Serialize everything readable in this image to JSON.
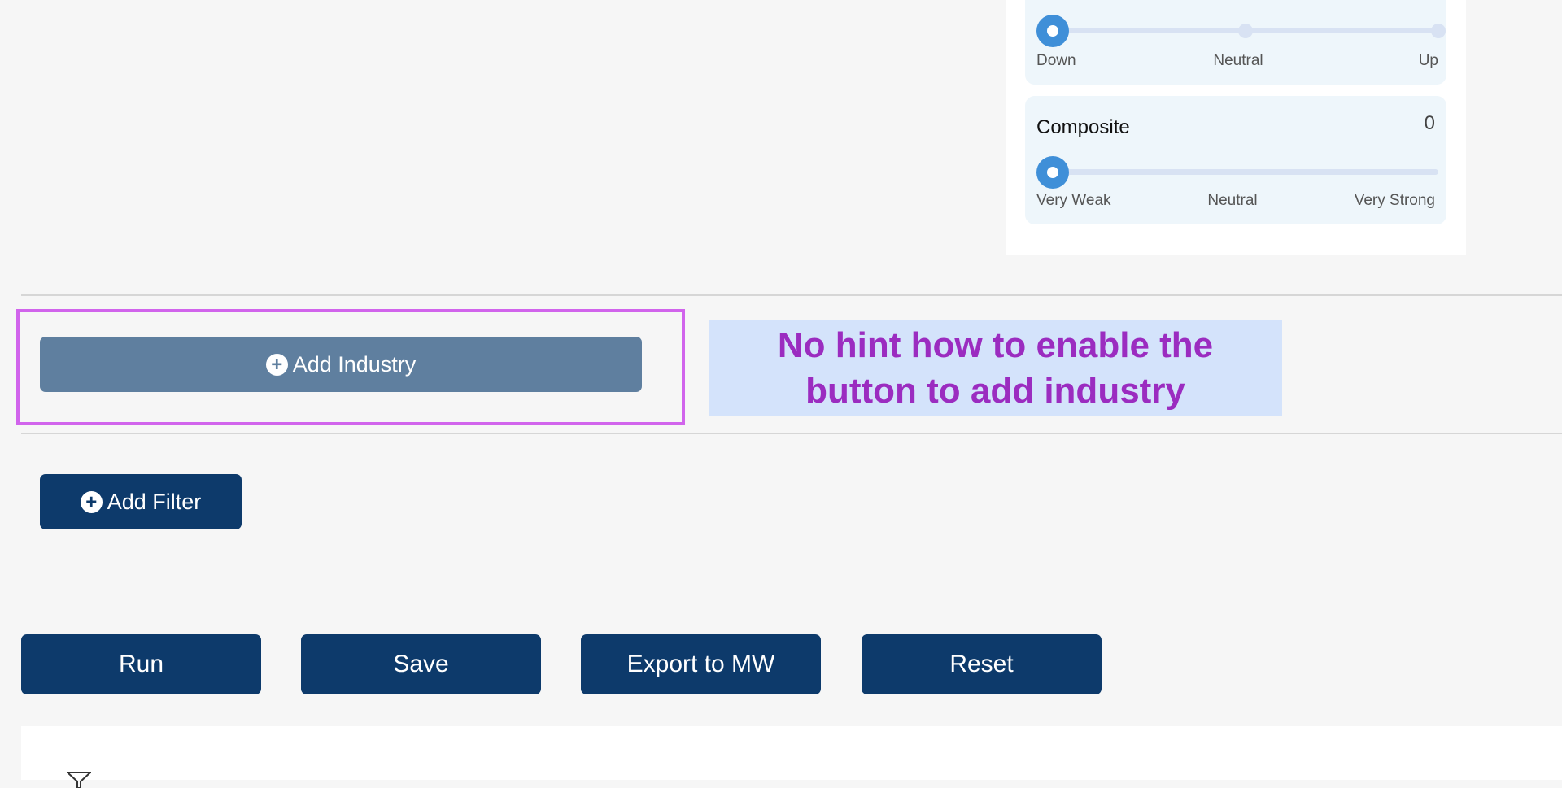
{
  "trend_card": {
    "value_fraction": 0,
    "labels": [
      "Down",
      "Neutral",
      "Up"
    ]
  },
  "composite_card": {
    "title": "Composite",
    "value": "0",
    "value_fraction": 0,
    "labels": [
      "Very Weak",
      "Neutral",
      "Very Strong"
    ]
  },
  "industry": {
    "add_label": "Add Industry"
  },
  "filters": {
    "add_label": "Add Filter"
  },
  "actions": {
    "run": "Run",
    "save": "Save",
    "export": "Export to MW",
    "reset": "Reset"
  },
  "annotation": {
    "line1": "No hint how to enable the",
    "line2": "button to add industry"
  },
  "colors": {
    "primary": "#0d3a6b",
    "disabled": "#5f7f9f",
    "slider_thumb": "#3f8fd8",
    "annotation_text": "#9b2cc0",
    "highlight_border": "#d164ec"
  }
}
